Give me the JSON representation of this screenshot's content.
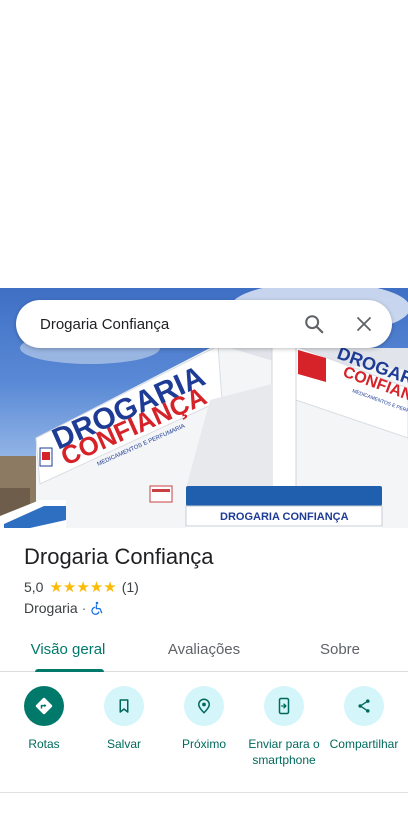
{
  "search": {
    "query": "Drogaria Confiança"
  },
  "photo": {
    "sign_main": "DROGARIA",
    "sign_sub": "CONFIANÇA",
    "sign_tagline": "MEDICAMENTOS E PERFUMARIA",
    "side_sign_main": "DROGARIA",
    "side_sign_sub": "CONFIANÇA",
    "side_sign_tagline": "MEDICAMENTOS E PERFUMARIA",
    "awning_text": "DROGARIA   CONFIANÇA"
  },
  "place": {
    "name": "Drogaria Confiança",
    "rating": "5,0",
    "stars": "★★★★★",
    "review_count": "(1)",
    "category": "Drogaria",
    "separator": "·"
  },
  "tabs": [
    {
      "label": "Visão geral",
      "active": true
    },
    {
      "label": "Avaliações",
      "active": false
    },
    {
      "label": "Sobre",
      "active": false
    }
  ],
  "actions": [
    {
      "label": "Rotas",
      "icon": "directions-icon"
    },
    {
      "label": "Salvar",
      "icon": "bookmark-icon"
    },
    {
      "label": "Próximo",
      "icon": "nearby-icon"
    },
    {
      "label": "Enviar para o smartphone",
      "icon": "send-to-phone-icon"
    },
    {
      "label": "Compartilhar",
      "icon": "share-icon"
    }
  ],
  "colors": {
    "accent": "#00796b",
    "action_bg": "#d4f5f9",
    "star": "#fbbc04"
  }
}
